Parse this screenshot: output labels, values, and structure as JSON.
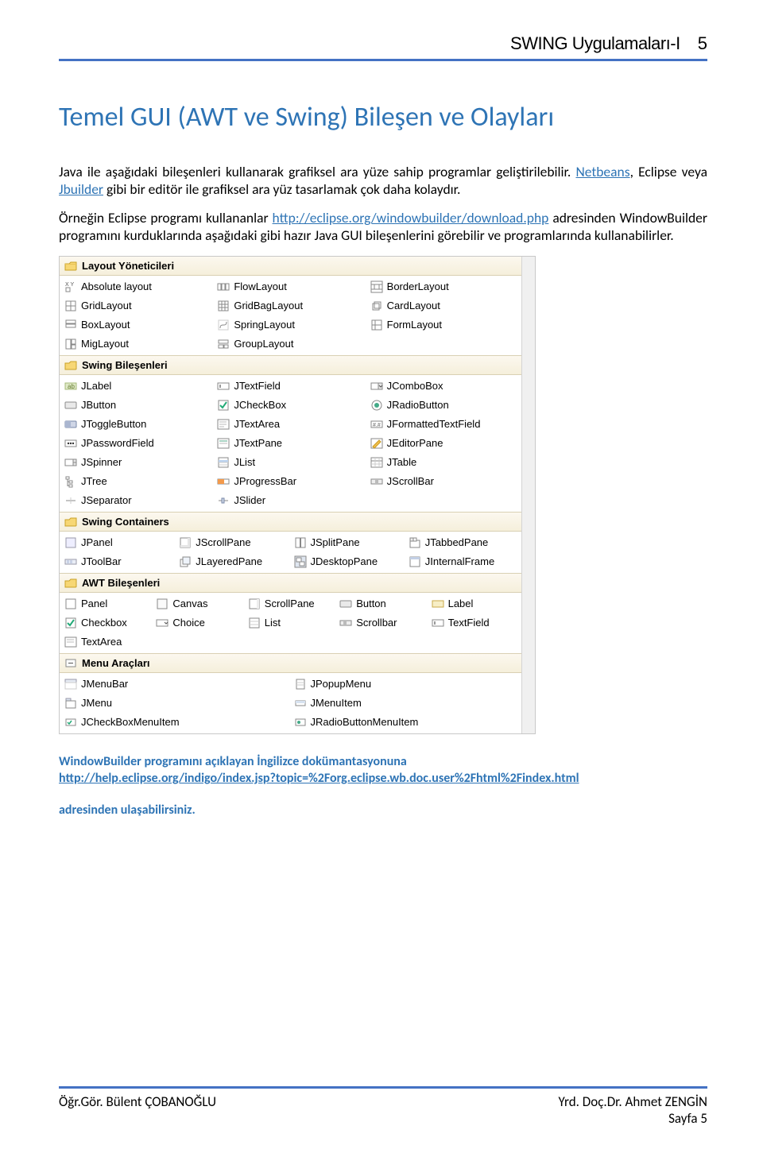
{
  "header": {
    "title": "SWING Uygulamaları-I",
    "page_num": "5"
  },
  "h1": "Temel GUI (AWT ve Swing) Bileşen ve Olayları",
  "p1_a": "Java ile aşağıdaki bileşenleri kullanarak grafiksel ara yüze sahip programlar geliştirilebilir. ",
  "p1_b": "Netbeans",
  "p1_c": ", Eclipse veya ",
  "p1_d": "Jbuilder",
  "p1_e": " gibi bir editör ile grafiksel ara yüz tasarlamak çok daha kolaydır.",
  "p2_a": "Örneğin  Eclipse  programı  kullananlar  ",
  "p2_b": "http://eclipse.org/windowbuilder/download.php",
  "p2_c": " adresinden  WindowBuilder  programını  kurduklarında  aşağıdaki  gibi  hazır  Java  GUI  bileşenlerini görebilir ve programlarında kullanabilirler.",
  "palette": {
    "cat1": "Layout Yöneticileri",
    "layouts": [
      "Absolute layout",
      "FlowLayout",
      "BorderLayout",
      "GridLayout",
      "GridBagLayout",
      "CardLayout",
      "BoxLayout",
      "SpringLayout",
      "FormLayout",
      "MigLayout",
      "GroupLayout"
    ],
    "cat2": "Swing Bileşenleri",
    "swing": [
      "JLabel",
      "JTextField",
      "JComboBox",
      "JButton",
      "JCheckBox",
      "JRadioButton",
      "JToggleButton",
      "JTextArea",
      "JFormattedTextField",
      "JPasswordField",
      "JTextPane",
      "JEditorPane",
      "JSpinner",
      "JList",
      "JTable",
      "JTree",
      "JProgressBar",
      "JScrollBar",
      "JSeparator",
      "JSlider"
    ],
    "cat3": "Swing Containers",
    "containers": [
      "JPanel",
      "JScrollPane",
      "JSplitPane",
      "JTabbedPane",
      "JToolBar",
      "JLayeredPane",
      "JDesktopPane",
      "JInternalFrame"
    ],
    "cat4": "AWT Bileşenleri",
    "awt": [
      "Panel",
      "Canvas",
      "ScrollPane",
      "Button",
      "Label",
      "Checkbox",
      "Choice",
      "List",
      "Scrollbar",
      "TextField",
      "TextArea"
    ],
    "cat5": "Menu Araçları",
    "menus": [
      "JMenuBar",
      "JPopupMenu",
      "JMenu",
      "JMenuItem",
      "JCheckBoxMenuItem",
      "JRadioButtonMenuItem"
    ]
  },
  "note_a": "WindowBuilder programını açıklayan İngilizce dokümantasyonuna",
  "note_b": "http://help.eclipse.org/indigo/index.jsp?topic=%2Forg.eclipse.wb.doc.user%2Fhtml%2Findex.html",
  "note_c": "adresinden ulaşabilirsiniz.",
  "footer": {
    "left": "Öğr.Gör. Bülent ÇOBANOĞLU",
    "right1": "Yrd. Doç.Dr. Ahmet ZENGİN",
    "right2": "Sayfa 5"
  }
}
